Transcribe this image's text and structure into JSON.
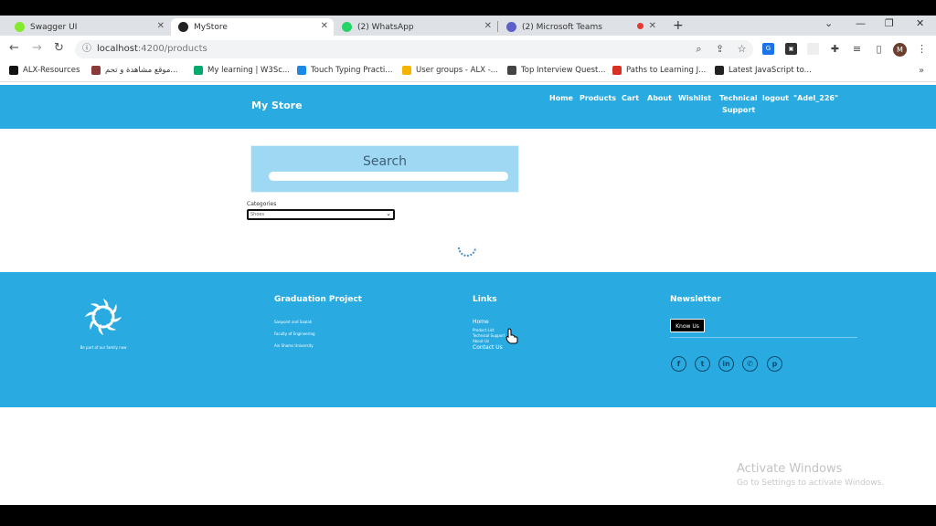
{
  "tabs": [
    {
      "title": "Swagger UI",
      "color": "#85ea2d"
    },
    {
      "title": "MyStore",
      "color": "#222222"
    },
    {
      "title": "(2) WhatsApp",
      "color": "#25d366"
    },
    {
      "title": "(2) Microsoft Teams",
      "color": "#5b5fc7"
    }
  ],
  "address": {
    "host": "localhost",
    "path": ":4200/products"
  },
  "bookmarks": [
    {
      "label": "ALX-Resources",
      "color": "#111111"
    },
    {
      "label": "موقع مشاهدة و تحم...",
      "color": "#8b3a3a"
    },
    {
      "label": "My learning | W3Sc...",
      "color": "#04aa6d"
    },
    {
      "label": "Touch Typing Practi...",
      "color": "#1e88e5"
    },
    {
      "label": "User groups - ALX -...",
      "color": "#f4b400"
    },
    {
      "label": "Top Interview Quest...",
      "color": "#444444"
    },
    {
      "label": "Paths to Learning J...",
      "color": "#d93025"
    },
    {
      "label": "Latest JavaScript to...",
      "color": "#222222"
    }
  ],
  "header": {
    "brand": "My Store",
    "nav": [
      "Home",
      "Products",
      "Cart",
      "About",
      "Wishlist",
      "Technical",
      "Support",
      "logout",
      "\"Adel_226\""
    ]
  },
  "search": {
    "title": "Search",
    "placeholder": ""
  },
  "categories": {
    "label": "Categories",
    "value": "Shoes"
  },
  "footer": {
    "logo_tagline": "Be part of our family now",
    "graduation_title": "Graduation Project",
    "graduation_lines": [
      "Sanpoint and Saalah",
      "Faculty of Engineering",
      "Ain Shams University"
    ],
    "links_title": "Links",
    "links": [
      "Home",
      "Product List",
      "Technical Support",
      "About Us",
      "Contact Us"
    ],
    "newsletter_title": "Newsletter",
    "know_us": "Know Us",
    "social": [
      "facebook-icon",
      "twitter-icon",
      "linkedin-icon",
      "whatsapp-icon",
      "pinterest-icon"
    ]
  },
  "watermark": {
    "title": "Activate Windows",
    "subtitle": "Go to Settings to activate Windows."
  },
  "colors": {
    "header_blue": "#29abe2",
    "search_box": "#9fd8f3"
  }
}
